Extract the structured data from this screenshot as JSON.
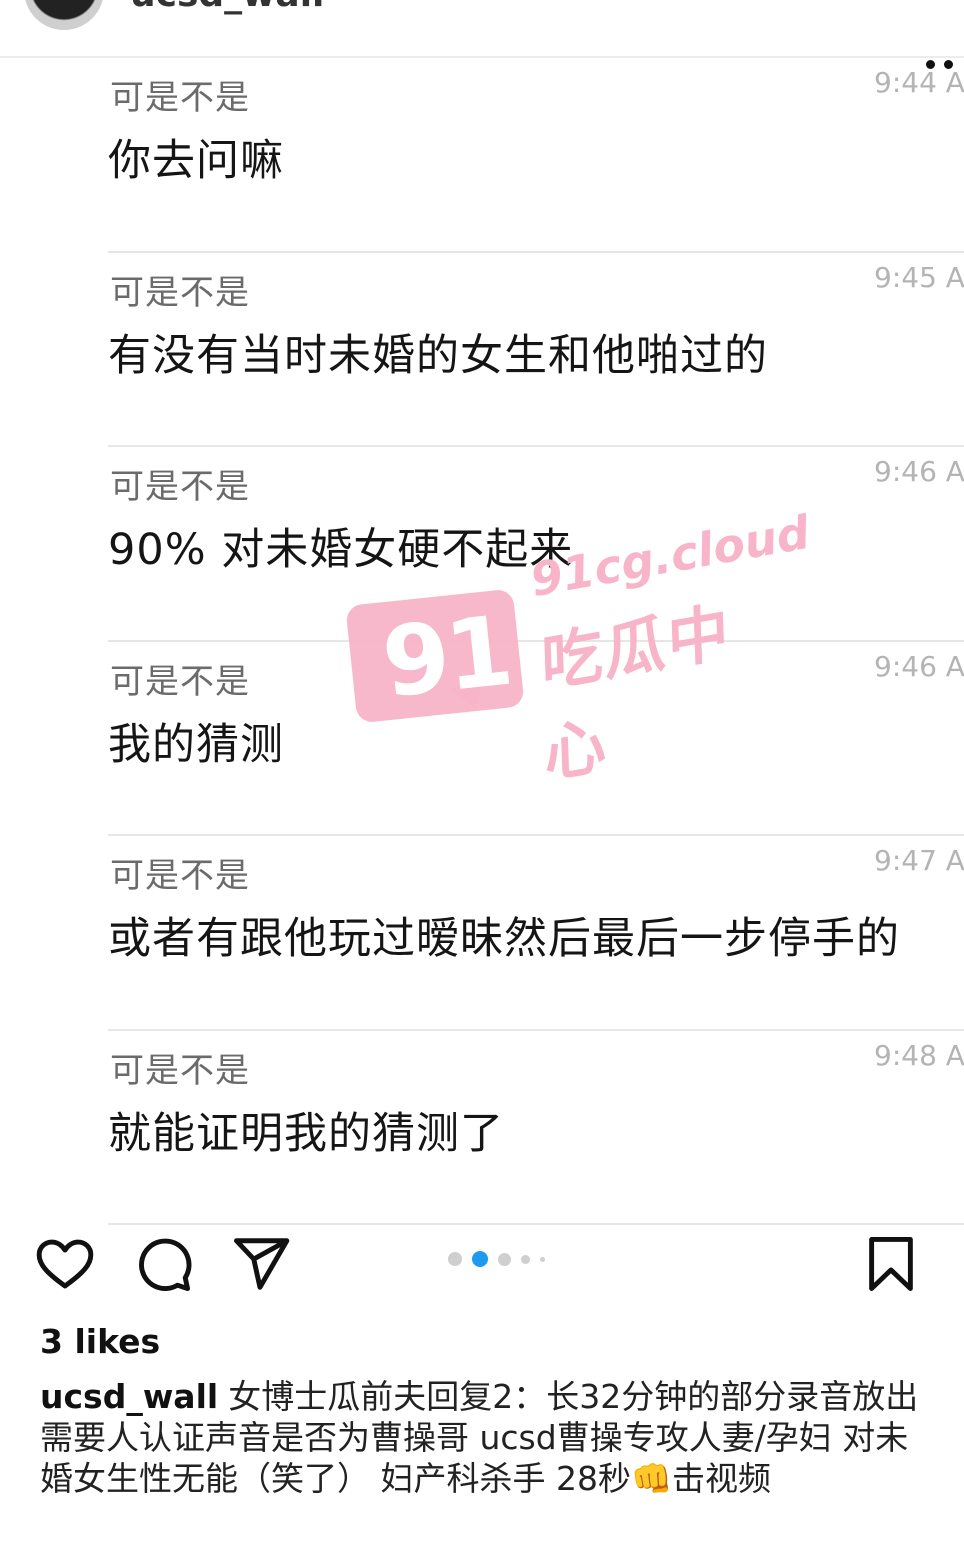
{
  "header": {
    "username": "ucsd_wall"
  },
  "messages": [
    {
      "sender": "可是不是",
      "time": "9:44 A",
      "text": "你去问嘛"
    },
    {
      "sender": "可是不是",
      "time": "9:45 A",
      "text": "有没有当时未婚的女生和他啪过的"
    },
    {
      "sender": "可是不是",
      "time": "9:46 A",
      "text": "90% 对未婚女硬不起来"
    },
    {
      "sender": "可是不是",
      "time": "9:46 A",
      "text": "我的猜测"
    },
    {
      "sender": "可是不是",
      "time": "9:47 A",
      "text": "或者有跟他玩过暧昧然后最后一步停手的"
    },
    {
      "sender": "可是不是",
      "time": "9:48 A",
      "text": "就能证明我的猜测了"
    }
  ],
  "watermark": {
    "number": "91",
    "domain": "91cg.cloud",
    "name": "吃瓜中心",
    "color": "#f8b4c8"
  },
  "actions": {
    "icons": [
      "heart-icon",
      "comment-icon",
      "share-icon",
      "bookmark-icon"
    ],
    "carousel_total": 5,
    "carousel_active": 2,
    "active_color": "#1d9bf0"
  },
  "post": {
    "likes": "3 likes",
    "caption_user": "ucsd_wall",
    "caption_text": "女博士瓜前夫回复2：长32分钟的部分录音放出 需要人认证声音是否为曹操哥 ucsd曹操专攻人妻/孕妇 对未婚女生性无能（笑了） 妇产科杀手 28秒👊击视频"
  }
}
